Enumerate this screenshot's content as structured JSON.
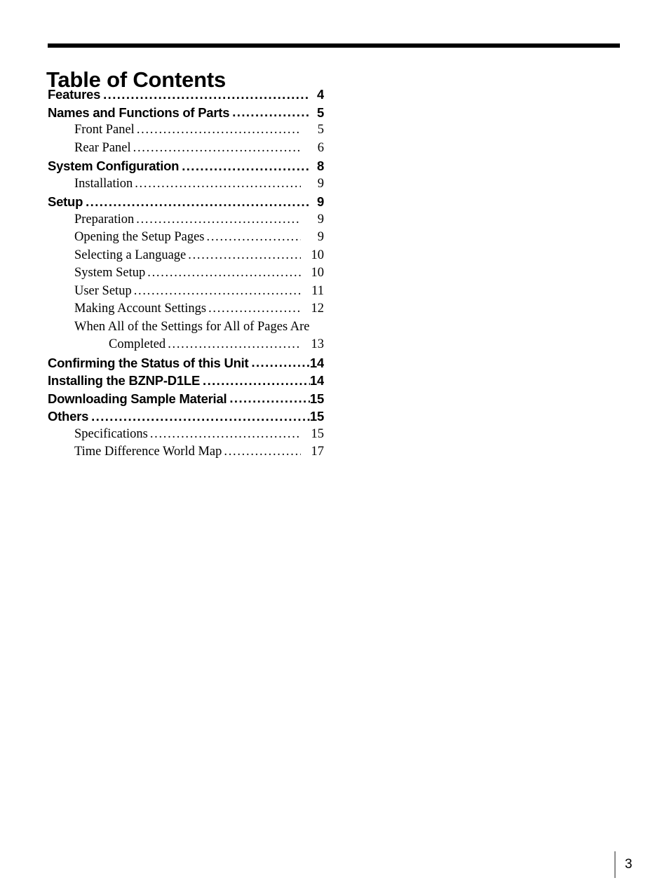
{
  "document": {
    "title": "Table of Contents",
    "page_number": "3",
    "leader_dots": "................................................................................................................"
  },
  "toc": {
    "entries": [
      {
        "level": 1,
        "label": "Features",
        "page": "4",
        "wrap": "none"
      },
      {
        "level": 1,
        "label": "Names and Functions of Parts",
        "page": "5",
        "wrap": "none"
      },
      {
        "level": 2,
        "label": "Front Panel",
        "page": "5",
        "wrap": "none"
      },
      {
        "level": 2,
        "label": "Rear Panel",
        "page": "6",
        "wrap": "none"
      },
      {
        "level": 1,
        "label": "System Configuration",
        "page": "8",
        "wrap": "none"
      },
      {
        "level": 2,
        "label": "Installation",
        "page": "9",
        "wrap": "none"
      },
      {
        "level": 1,
        "label": "Setup",
        "page": "9",
        "wrap": "none"
      },
      {
        "level": 2,
        "label": "Preparation",
        "page": "9",
        "wrap": "none"
      },
      {
        "level": 2,
        "label": "Opening the Setup Pages",
        "page": "9",
        "wrap": "none"
      },
      {
        "level": 2,
        "label": "Selecting a Language",
        "page": "10",
        "wrap": "none"
      },
      {
        "level": 2,
        "label": "System Setup",
        "page": "10",
        "wrap": "none"
      },
      {
        "level": 2,
        "label": "User Setup",
        "page": "11",
        "wrap": "none"
      },
      {
        "level": 2,
        "label": "Making Account Settings",
        "page": "12",
        "wrap": "none"
      },
      {
        "level": 2,
        "label": "When All of the Settings for All of Pages Are",
        "page": "",
        "wrap": "first"
      },
      {
        "level": 2,
        "label": "Completed",
        "page": "13",
        "wrap": "cont"
      },
      {
        "level": 1,
        "label": "Confirming the Status of this Unit",
        "page": "14",
        "wrap": "none"
      },
      {
        "level": 1,
        "label": "Installing the BZNP-D1LE",
        "page": "14",
        "wrap": "none"
      },
      {
        "level": 1,
        "label": "Downloading Sample Material",
        "page": "15",
        "wrap": "none"
      },
      {
        "level": 1,
        "label": "Others",
        "page": "15",
        "wrap": "none"
      },
      {
        "level": 2,
        "label": "Specifications",
        "page": "15",
        "wrap": "none"
      },
      {
        "level": 2,
        "label": "Time Difference World Map",
        "page": "17",
        "wrap": "none"
      }
    ]
  }
}
